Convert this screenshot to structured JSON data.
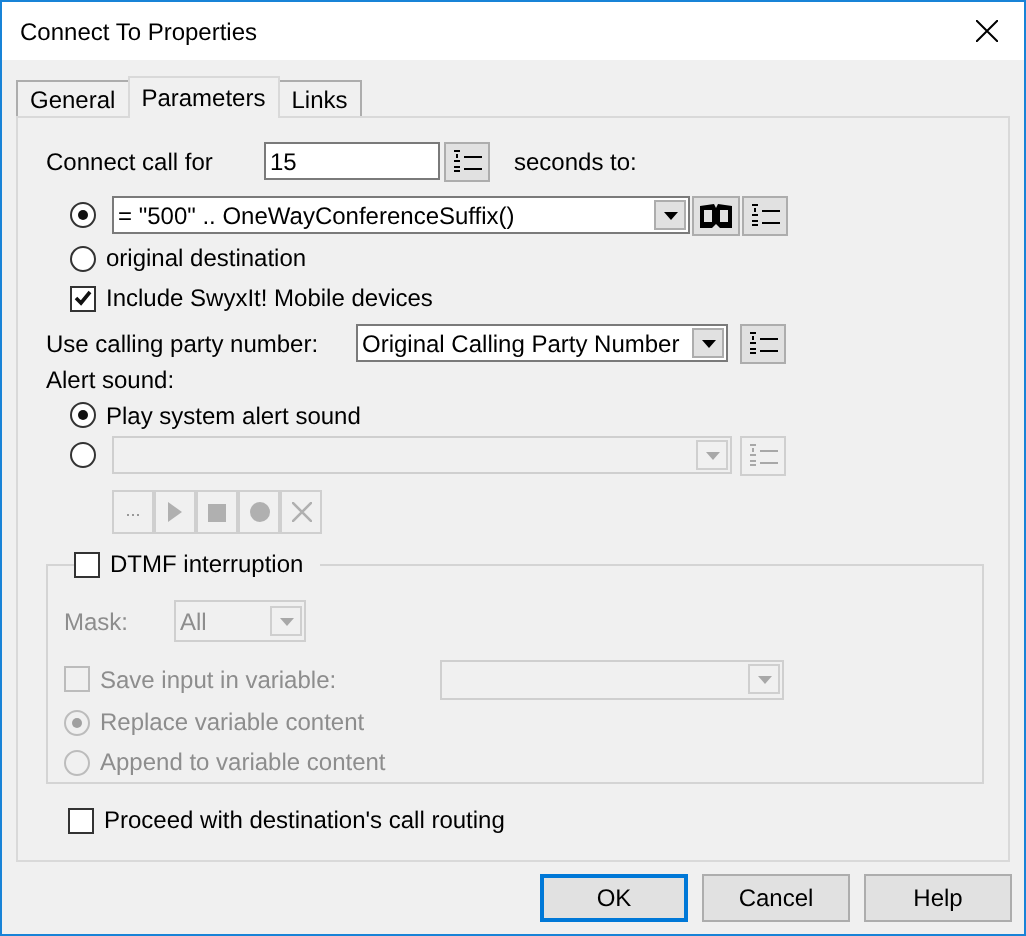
{
  "window": {
    "title": "Connect To Properties"
  },
  "tabs": [
    {
      "label": "General",
      "selected": false
    },
    {
      "label": "Parameters",
      "selected": true
    },
    {
      "label": "Links",
      "selected": false
    }
  ],
  "connect_call": {
    "label": "Connect call for",
    "value": "15",
    "suffix": "seconds to:"
  },
  "destination_options": [
    {
      "kind": "combo",
      "selected": true,
      "value": "= \"500\" .. OneWayConferenceSuffix()"
    },
    {
      "kind": "text",
      "selected": false,
      "label": "original destination"
    }
  ],
  "include_mobile": {
    "label": "Include SwyxIt! Mobile devices",
    "checked": true
  },
  "calling_party": {
    "label": "Use calling party number:",
    "value": "Original Calling Party Number"
  },
  "alert_sound": {
    "label": "Alert sound:",
    "options": [
      {
        "kind": "text",
        "selected": true,
        "label": "Play system alert sound"
      },
      {
        "kind": "combo",
        "selected": false,
        "disabled": true
      }
    ]
  },
  "sound_controls": [
    {
      "kind": "browse",
      "label": "...",
      "disabled": true
    },
    {
      "kind": "play",
      "disabled": true
    },
    {
      "kind": "stop",
      "disabled": true
    },
    {
      "kind": "record",
      "disabled": true
    },
    {
      "kind": "delete",
      "disabled": true
    }
  ],
  "dtmf": {
    "label": "DTMF interruption",
    "checked": false,
    "mask": {
      "label": "Mask:",
      "value": "All",
      "disabled": true
    },
    "save_input": {
      "label": "Save input in variable:",
      "checked": false,
      "disabled": true
    },
    "variable_mode": [
      {
        "label": "Replace variable content",
        "selected": true,
        "disabled": true
      },
      {
        "label": "Append to variable content",
        "selected": false,
        "disabled": true
      }
    ]
  },
  "proceed_routing": {
    "label": "Proceed with destination's call routing",
    "checked": false
  },
  "buttons": [
    {
      "label": "OK",
      "default": true
    },
    {
      "label": "Cancel",
      "default": false
    },
    {
      "label": "Help",
      "default": false
    }
  ]
}
